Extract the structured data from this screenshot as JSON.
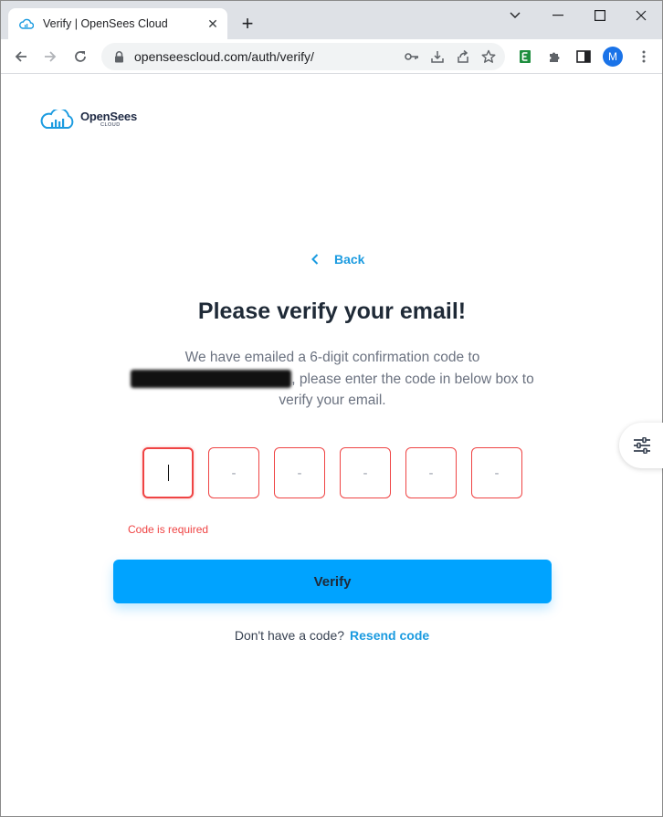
{
  "browser": {
    "tab_title": "Verify | OpenSees Cloud",
    "tab_close": "✕",
    "new_tab": "+",
    "url": "openseescloud.com/auth/verify/",
    "profile_initial": "M",
    "extension_letter": "E"
  },
  "logo": {
    "name": "OpenSees",
    "sub": "CLOUD"
  },
  "page": {
    "back_label": "Back",
    "heading": "Please verify your email!",
    "description_before": "We have emailed a 6-digit confirmation code to",
    "description_after": ", please enter the code in below box to verify your email.",
    "code_placeholder": "-",
    "error": "Code is required",
    "verify_label": "Verify",
    "no_code_text": "Don't have a code?",
    "resend_label": "Resend code"
  },
  "colors": {
    "accent": "#00a3ff",
    "link": "#1b9be0",
    "error": "#ef4444",
    "heading": "#1f2a37"
  }
}
